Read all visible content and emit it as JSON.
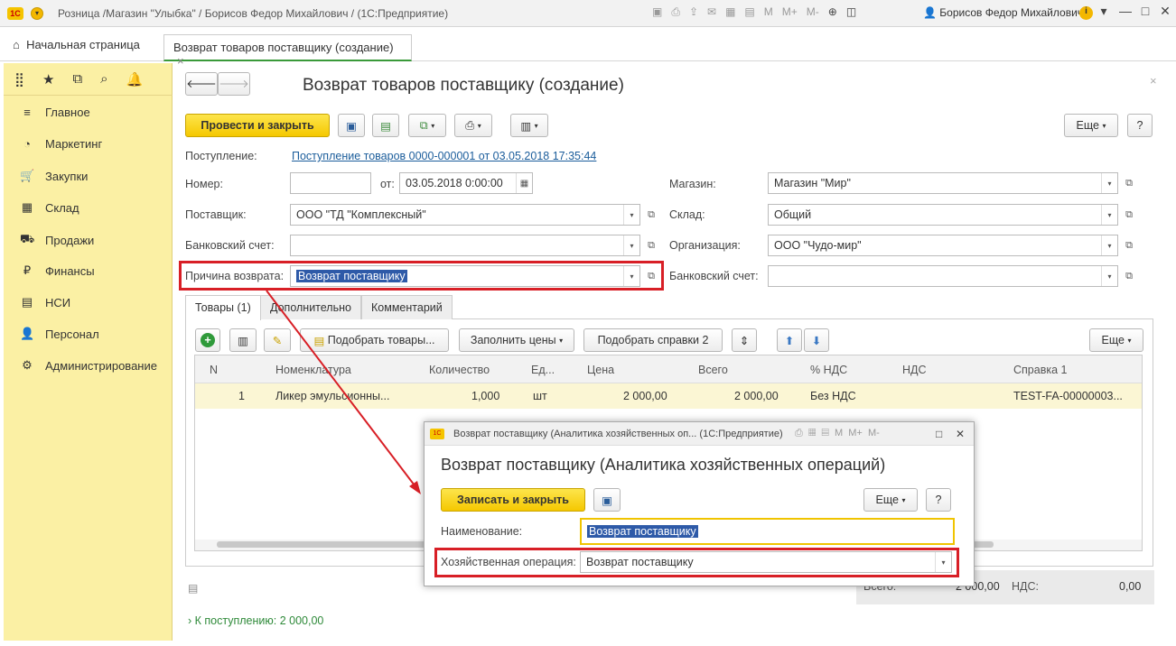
{
  "titlebar": {
    "logo": "1С",
    "title": "Розница /Магазин \"Улыбка\" / Борисов Федор Михайлович /  (1С:Предприятие)",
    "icons": [
      "save-icon",
      "print-icon",
      "upload-icon",
      "mail-icon",
      "calendar-icon",
      "calendar31-icon",
      "m-icon",
      "mplus-icon",
      "mminus-icon",
      "zoom-icon",
      "panel-icon"
    ],
    "m": "M",
    "mplus": "M+",
    "mminus": "M-",
    "user": "Борисов Федор Михайлович",
    "info": "i"
  },
  "tabs": {
    "home": "Начальная страница",
    "active": "Возврат товаров поставщику (создание)",
    "close": "×"
  },
  "sidebar": {
    "items": [
      {
        "label": "Главное",
        "icon": "≡"
      },
      {
        "label": "Маркетинг",
        "icon": "◔"
      },
      {
        "label": "Закупки",
        "icon": "🛒"
      },
      {
        "label": "Склад",
        "icon": "▦"
      },
      {
        "label": "Продажи",
        "icon": "⛟"
      },
      {
        "label": "Финансы",
        "icon": "₽"
      },
      {
        "label": "НСИ",
        "icon": "▤"
      },
      {
        "label": "Персонал",
        "icon": "👤"
      },
      {
        "label": "Администрирование",
        "icon": "⚙"
      }
    ]
  },
  "form": {
    "title": "Возврат товаров поставщику (создание)",
    "post_close": "Провести и закрыть",
    "more": "Еще",
    "help": "?",
    "receipt_label": "Поступление:",
    "receipt_link": "Поступление товаров 0000-000001 от 03.05.2018 17:35:44",
    "number_label": "Номер:",
    "number_value": "",
    "from_label": "от:",
    "date_value": "03.05.2018  0:00:00",
    "store_label": "Магазин:",
    "store_value": "Магазин \"Мир\"",
    "supplier_label": "Поставщик:",
    "supplier_value": "ООО \"ТД \"Комплексный\"",
    "warehouse_label": "Склад:",
    "warehouse_value": "Общий",
    "bank_label": "Банковский счет:",
    "bank_value": "",
    "org_label": "Организация:",
    "org_value": "ООО \"Чудо-мир\"",
    "reason_label": "Причина возврата:",
    "reason_value": "Возврат поставщику",
    "bank2_label": "Банковский счет:",
    "bank2_value": ""
  },
  "form_tabs": [
    "Товары (1)",
    "Дополнительно",
    "Комментарий"
  ],
  "grid_toolbar": {
    "pick_goods": "Подобрать товары...",
    "fill_prices": "Заполнить цены",
    "pick_refs": "Подобрать справки 2",
    "more": "Еще"
  },
  "grid": {
    "headers": [
      "N",
      "Номенклатура",
      "Количество",
      "Ед...",
      "Цена",
      "Всего",
      "% НДС",
      "НДС",
      "Справка 1"
    ],
    "rows": [
      [
        "1",
        "Ликер эмульсионны...",
        "1,000",
        "шт",
        "2 000,00",
        "2 000,00",
        "Без НДС",
        "",
        "TEST-FA-00000003..."
      ]
    ]
  },
  "totals": {
    "total_label": "Всего:",
    "total_value": "2 000,00",
    "vat_label": "НДС:",
    "vat_value": "0,00"
  },
  "footer_link": "К поступлению: 2 000,00",
  "modal": {
    "window_title": "Возврат поставщику (Аналитика хозяйственных оп...  (1С:Предприятие)",
    "heading": "Возврат поставщику (Аналитика хозяйственных операций)",
    "save_close": "Записать и закрыть",
    "more": "Еще",
    "help": "?",
    "name_label": "Наименование:",
    "name_value": "Возврат поставщику",
    "op_label": "Хозяйственная операция:",
    "op_value": "Возврат поставщику",
    "m": "M",
    "mplus": "M+",
    "mminus": "M-"
  },
  "colors": {
    "accent_yellow": "#f5c800",
    "sidebar_bg": "#fbf0a4",
    "highlight_red": "#d81f26",
    "link_blue": "#1b5d9b",
    "selection_blue": "#2e5aa8"
  }
}
